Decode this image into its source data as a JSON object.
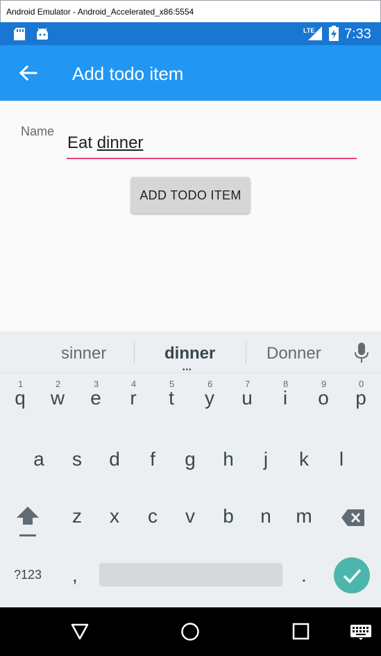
{
  "window": {
    "title": "Android Emulator - Android_Accelerated_x86:5554"
  },
  "status_bar": {
    "network": "LTE",
    "time": "7:33"
  },
  "app_bar": {
    "title": "Add todo item"
  },
  "form": {
    "name_label": "Name",
    "name_value_prefix": "Eat ",
    "name_value_word": "dinner",
    "add_button_label": "ADD TODO ITEM"
  },
  "keyboard": {
    "suggestions": [
      "sinner",
      "dinner",
      "Donner"
    ],
    "more_indicator": "•••",
    "row1": [
      {
        "key": "q",
        "hint": "1"
      },
      {
        "key": "w",
        "hint": "2"
      },
      {
        "key": "e",
        "hint": "3"
      },
      {
        "key": "r",
        "hint": "4"
      },
      {
        "key": "t",
        "hint": "5"
      },
      {
        "key": "y",
        "hint": "6"
      },
      {
        "key": "u",
        "hint": "7"
      },
      {
        "key": "i",
        "hint": "8"
      },
      {
        "key": "o",
        "hint": "9"
      },
      {
        "key": "p",
        "hint": "0"
      }
    ],
    "row2": [
      "a",
      "s",
      "d",
      "f",
      "g",
      "h",
      "j",
      "k",
      "l"
    ],
    "row3": [
      "z",
      "x",
      "c",
      "v",
      "b",
      "n",
      "m"
    ],
    "symbols_label": "?123",
    "comma": ",",
    "period": "."
  },
  "icons": {
    "back": "arrow-left-icon",
    "sd_card": "sd-card-icon",
    "android": "android-icon",
    "signal": "signal-icon",
    "battery": "battery-charging-icon",
    "mic": "microphone-icon",
    "shift": "shift-icon",
    "backspace": "backspace-icon",
    "enter": "checkmark-icon",
    "nav_back": "triangle-back-icon",
    "nav_home": "circle-home-icon",
    "nav_recents": "square-recents-icon",
    "nav_keyboard": "keyboard-icon"
  },
  "colors": {
    "status_bar": "#1976d2",
    "app_bar": "#2196f3",
    "input_underline": "#ec407a",
    "enter_key": "#4db6ac"
  }
}
